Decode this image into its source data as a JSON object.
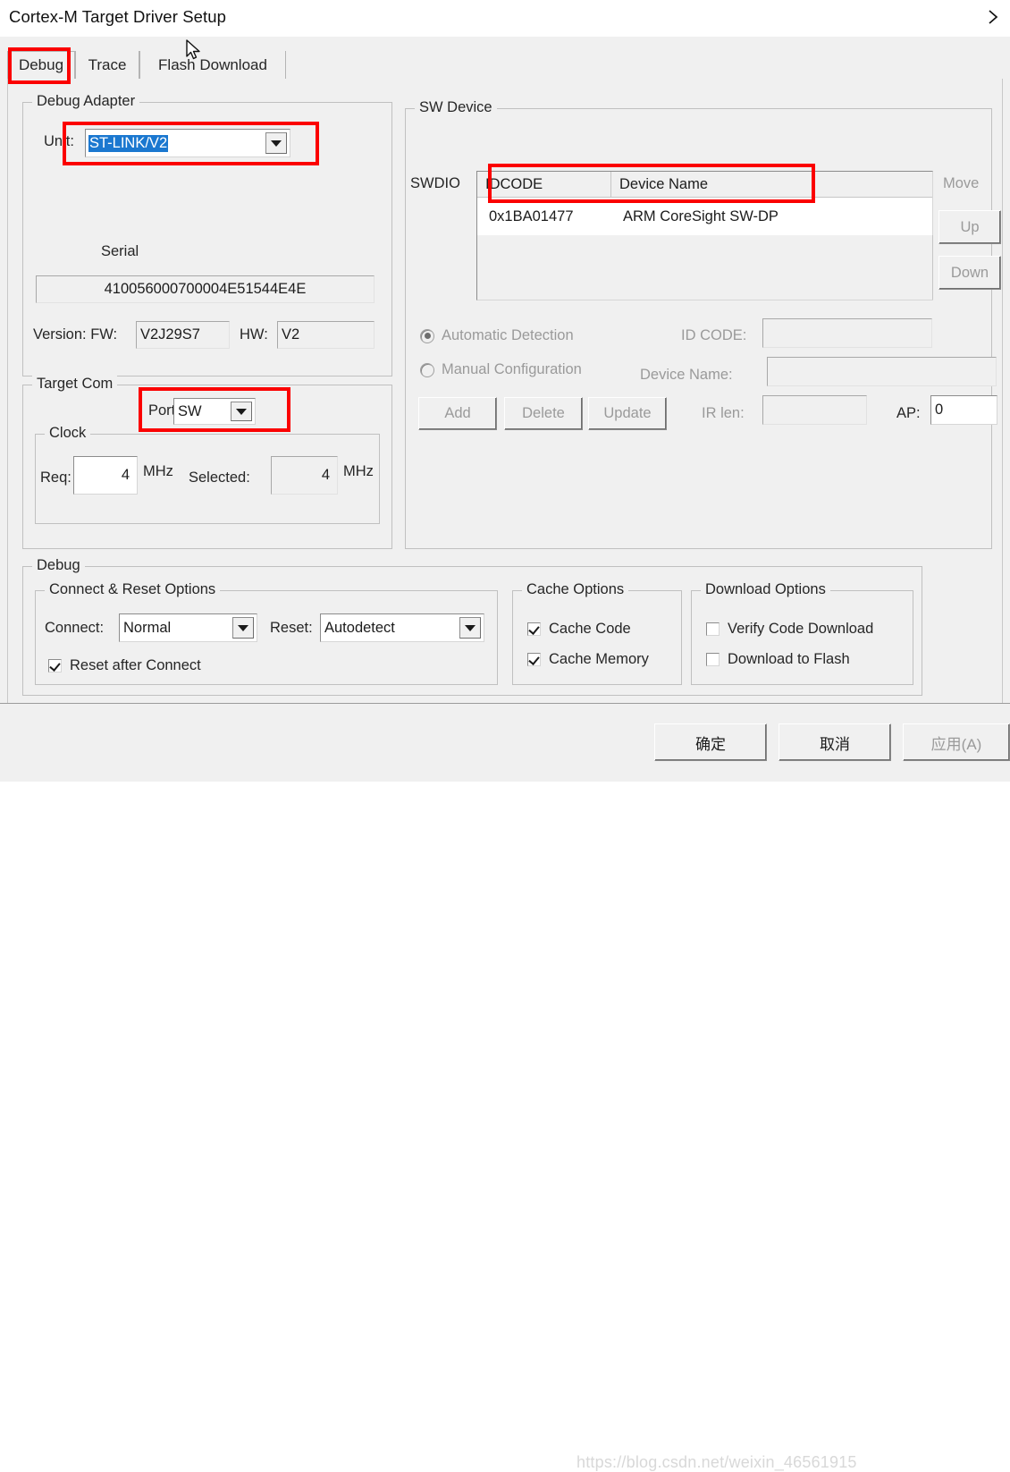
{
  "window": {
    "title": "Cortex-M Target Driver Setup",
    "expand_icon": "chevron-right-icon"
  },
  "tabs": [
    {
      "label": "Debug",
      "selected": true
    },
    {
      "label": "Trace",
      "selected": false
    },
    {
      "label": "Flash Download",
      "selected": false
    }
  ],
  "debug_adapter": {
    "group_label": "Debug Adapter",
    "unit_label": "Unit:",
    "unit_value": "ST-LINK/V2",
    "serial_label": "Serial",
    "serial_value": "410056000700004E51544E4E",
    "version_label": "Version: FW:",
    "fw_value": "V2J29S7",
    "hw_label": "HW:",
    "hw_value": "V2"
  },
  "target_com": {
    "group_label": "Target Com",
    "port_label": "Port:",
    "port_value": "SW",
    "clock_label": "Clock",
    "req_label": "Req:",
    "req_value": "4",
    "req_unit": "MHz",
    "selected_label": "Selected:",
    "selected_value": "4",
    "selected_unit": "MHz"
  },
  "sw_device": {
    "group_label": "SW Device",
    "swdio_label": "SWDIO",
    "columns": [
      "IDCODE",
      "Device Name",
      ""
    ],
    "rows": [
      {
        "idcode": "0x1BA01477",
        "device_name": "ARM CoreSight SW-DP",
        "extra": ""
      }
    ],
    "move_label": "Move",
    "up_label": "Up",
    "down_label": "Down",
    "automatic_detection_label": "Automatic Detection",
    "automatic_detection_checked": true,
    "manual_configuration_label": "Manual Configuration",
    "manual_configuration_checked": false,
    "add_label": "Add",
    "delete_label": "Delete",
    "update_label": "Update",
    "idcode_label": "ID CODE:",
    "idcode_value": "",
    "device_name_label": "Device Name:",
    "device_name_value": "",
    "irlen_label": "IR len:",
    "irlen_value": "",
    "ap_label": "AP:",
    "ap_value": "0"
  },
  "debug_section": {
    "group_label": "Debug",
    "connect_reset": {
      "group_label": "Connect & Reset Options",
      "connect_label": "Connect:",
      "connect_value": "Normal",
      "reset_label": "Reset:",
      "reset_value": "Autodetect",
      "reset_after_connect_label": "Reset after Connect",
      "reset_after_connect_checked": true
    },
    "cache_options": {
      "group_label": "Cache Options",
      "cache_code_label": "Cache Code",
      "cache_code_checked": true,
      "cache_memory_label": "Cache Memory",
      "cache_memory_checked": true
    },
    "download_options": {
      "group_label": "Download Options",
      "verify_code_download_label": "Verify Code Download",
      "verify_code_download_checked": false,
      "download_to_flash_label": "Download to Flash",
      "download_to_flash_checked": false
    }
  },
  "footer": {
    "ok_label": "确定",
    "cancel_label": "取消",
    "apply_label": "应用(A)"
  },
  "watermark": {
    "text": "https://blog.csdn.net/weixin_46561915"
  },
  "colors": {
    "accent_selection": "#1b78d0",
    "annotation": "#fb0000",
    "dialog_bg": "#f0f0f0"
  }
}
